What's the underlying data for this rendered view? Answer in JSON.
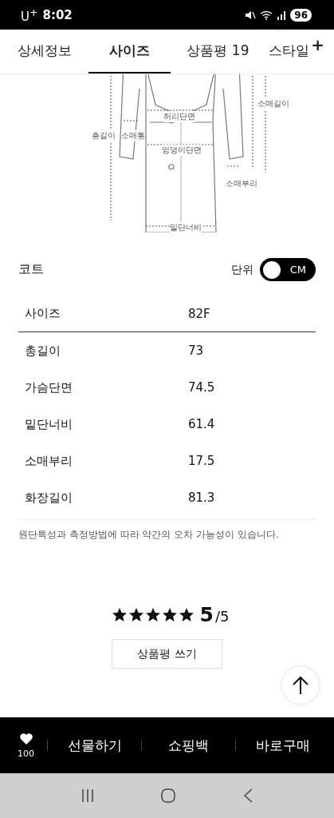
{
  "status_bar": {
    "carrier": "U$^{+}$",
    "time": "8:02",
    "battery": "96"
  },
  "tabs": [
    {
      "label": "상세정보",
      "selected": false
    },
    {
      "label": "사이즈",
      "selected": true
    },
    {
      "label": "상품평 19",
      "selected": false
    },
    {
      "label": "스타일",
      "selected": false,
      "badge": "+"
    }
  ],
  "diagram": {
    "labels": [
      {
        "kind": "sleeve_length",
        "text": "소매길이"
      },
      {
        "kind": "total_length",
        "text": "총길이"
      },
      {
        "kind": "sleeve_width",
        "text": "소매통"
      },
      {
        "kind": "waist",
        "text": "허리단면"
      },
      {
        "kind": "hip",
        "text": "엉덩이단면"
      },
      {
        "kind": "cuff",
        "text": "소매부리"
      },
      {
        "kind": "hem",
        "text": "밑단너비"
      }
    ]
  },
  "size_table": {
    "title": "코트",
    "unit_label": "단위",
    "unit_toggle": {
      "label": "CM"
    },
    "header": [
      "사이즈",
      "82F"
    ],
    "rows": [
      [
        "총길이",
        "73"
      ],
      [
        "가슴단면",
        "74.5"
      ],
      [
        "밑단너비",
        "61.4"
      ],
      [
        "소매부리",
        "17.5"
      ],
      [
        "화장길이",
        "81.3"
      ]
    ],
    "note": "원단특성과 측정방법에 따라 약간의 오차 가능성이 있습니다."
  },
  "rating": {
    "stars": 5,
    "score": "5",
    "total": "/5"
  },
  "write_review_button": "상품평 쓰기",
  "bottom_bar": {
    "likes": "100",
    "actions": [
      "선물하기",
      "쇼핑백",
      "바로구매"
    ]
  }
}
